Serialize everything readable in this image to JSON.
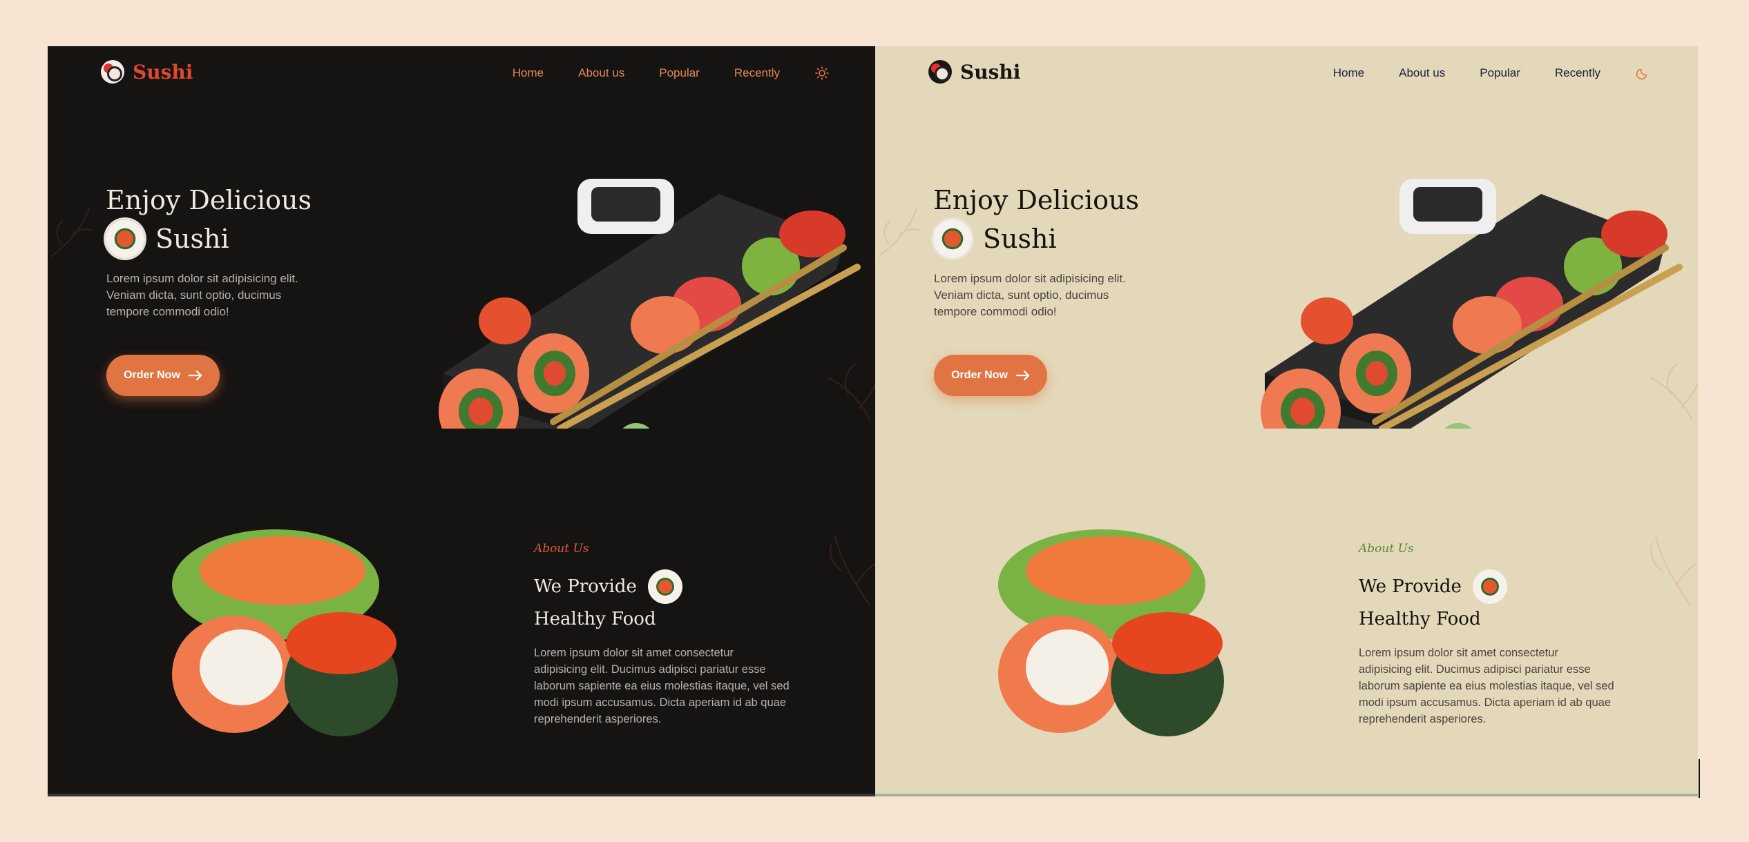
{
  "brand": {
    "name": "Sushi"
  },
  "nav": {
    "items": [
      "Home",
      "About us",
      "Popular",
      "Recently"
    ]
  },
  "hero": {
    "title_line1": "Enjoy Delicious",
    "title_line2": "Sushi",
    "description": "Lorem ipsum dolor sit adipisicing elit. Veniam dicta, sunt optio, ducimus tempore commodi odio!",
    "cta": "Order Now"
  },
  "about": {
    "kicker": "About Us",
    "title_line1": "We Provide",
    "title_line2": "Healthy Food",
    "text": "Lorem ipsum dolor sit amet consectetur adipisicing elit. Ducimus adipisci pariatur esse laborum sapiente ea eius molestias itaque, vel sed modi ipsum accusamus. Dicta aperiam id ab quae reprehenderit asperiores."
  },
  "themes": [
    {
      "name": "dark",
      "toggle_icon": "sun-icon",
      "accent": "#e07543",
      "background": "#161313"
    },
    {
      "name": "light",
      "toggle_icon": "moon-icon",
      "accent": "#e07543",
      "background": "#e3d8b9"
    }
  ]
}
